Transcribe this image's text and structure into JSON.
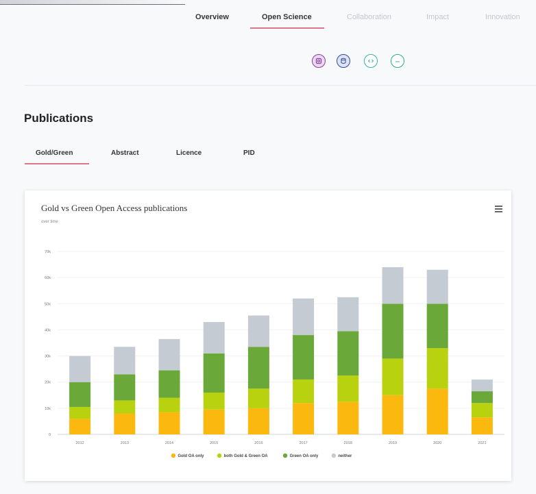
{
  "nav": {
    "tabs": [
      {
        "label": "Overview"
      },
      {
        "label": "Open Science"
      },
      {
        "label": "Collaboration"
      },
      {
        "label": "Impact"
      },
      {
        "label": "Innovation"
      }
    ]
  },
  "icons": [
    "publication-icon",
    "dataset-icon",
    "software-icon",
    "other-research-icon"
  ],
  "section": {
    "title": "Publications",
    "subtabs": [
      {
        "label": "Gold/Green"
      },
      {
        "label": "Abstract"
      },
      {
        "label": "Licence"
      },
      {
        "label": "PID"
      }
    ]
  },
  "chart_data": {
    "type": "bar",
    "stacked": true,
    "title": "Gold vs Green Open Access publications",
    "subtitle": "over time",
    "categories": [
      "2012",
      "2013",
      "2014",
      "2015",
      "2016",
      "2017",
      "2018",
      "2019",
      "2020",
      "2021"
    ],
    "ylim": [
      0,
      70000
    ],
    "y_ticks": [
      "0",
      "10k",
      "20k",
      "30k",
      "40k",
      "50k",
      "60k",
      "70k"
    ],
    "y_tick_values": [
      0,
      10000,
      20000,
      30000,
      40000,
      50000,
      60000,
      70000
    ],
    "grid": true,
    "legend_position": "bottom",
    "series": [
      {
        "name": "Gold OA only",
        "color": "#fbb80f",
        "values": [
          6000,
          8000,
          8500,
          9500,
          10000,
          12000,
          12500,
          15000,
          17500,
          6500
        ]
      },
      {
        "name": "both Gold & Green OA",
        "color": "#b9d20f",
        "values": [
          4500,
          5000,
          5500,
          6500,
          7500,
          9000,
          10000,
          14000,
          15500,
          5500
        ]
      },
      {
        "name": "Green OA only",
        "color": "#6aa83a",
        "values": [
          9500,
          10000,
          10500,
          15000,
          16000,
          17000,
          17000,
          21000,
          17000,
          4500
        ]
      },
      {
        "name": "neither",
        "color": "#c5cbd3",
        "values": [
          10000,
          10500,
          12000,
          12000,
          12000,
          14000,
          13000,
          14000,
          13000,
          4500
        ]
      }
    ]
  }
}
